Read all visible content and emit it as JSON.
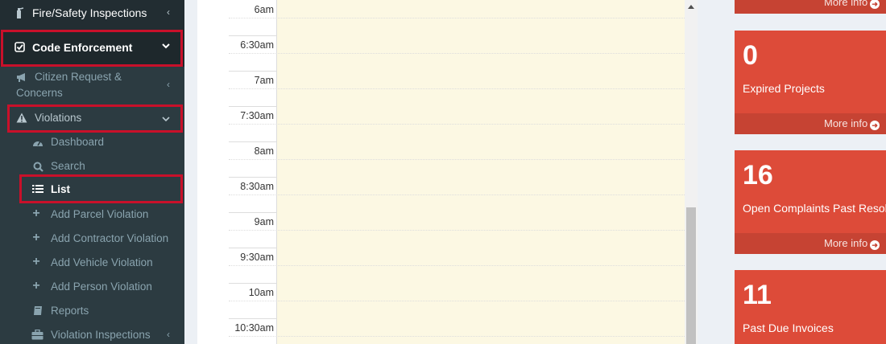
{
  "sidebar": {
    "fire_safety": "Fire/Safety Inspections",
    "code_enforcement": "Code Enforcement",
    "citizen_request_line1": "Citizen Request &",
    "citizen_request_line2": "Concerns",
    "violations": "Violations",
    "items": [
      {
        "label": "Dashboard",
        "icon": "dashboard-icon"
      },
      {
        "label": "Search",
        "icon": "search-icon"
      },
      {
        "label": "List",
        "icon": "list-icon"
      },
      {
        "label": "Add Parcel Violation",
        "icon": "plus-icon"
      },
      {
        "label": "Add Contractor Violation",
        "icon": "plus-icon"
      },
      {
        "label": "Add Vehicle Violation",
        "icon": "plus-icon"
      },
      {
        "label": "Add Person Violation",
        "icon": "plus-icon"
      },
      {
        "label": "Reports",
        "icon": "book-icon"
      },
      {
        "label": "Violation Inspections",
        "icon": "briefcase-icon"
      }
    ],
    "colors": {
      "bg": "#222d32",
      "highlight": "#c9102a"
    }
  },
  "calendar": {
    "slots": [
      "6am",
      "6:30am",
      "7am",
      "7:30am",
      "8am",
      "8:30am",
      "9am",
      "9:30am",
      "10am",
      "10:30am"
    ],
    "cell_color": "#fcf8e3"
  },
  "boxes": [
    {
      "number": "",
      "label": "",
      "footer": "More info"
    },
    {
      "number": "0",
      "label": "Expired Projects",
      "footer": "More info"
    },
    {
      "number": "16",
      "label": "Open Complaints Past Resolu",
      "footer": "More info"
    },
    {
      "number": "11",
      "label": "Past Due Invoices",
      "footer": ""
    }
  ],
  "box_color": "#dd4b39"
}
